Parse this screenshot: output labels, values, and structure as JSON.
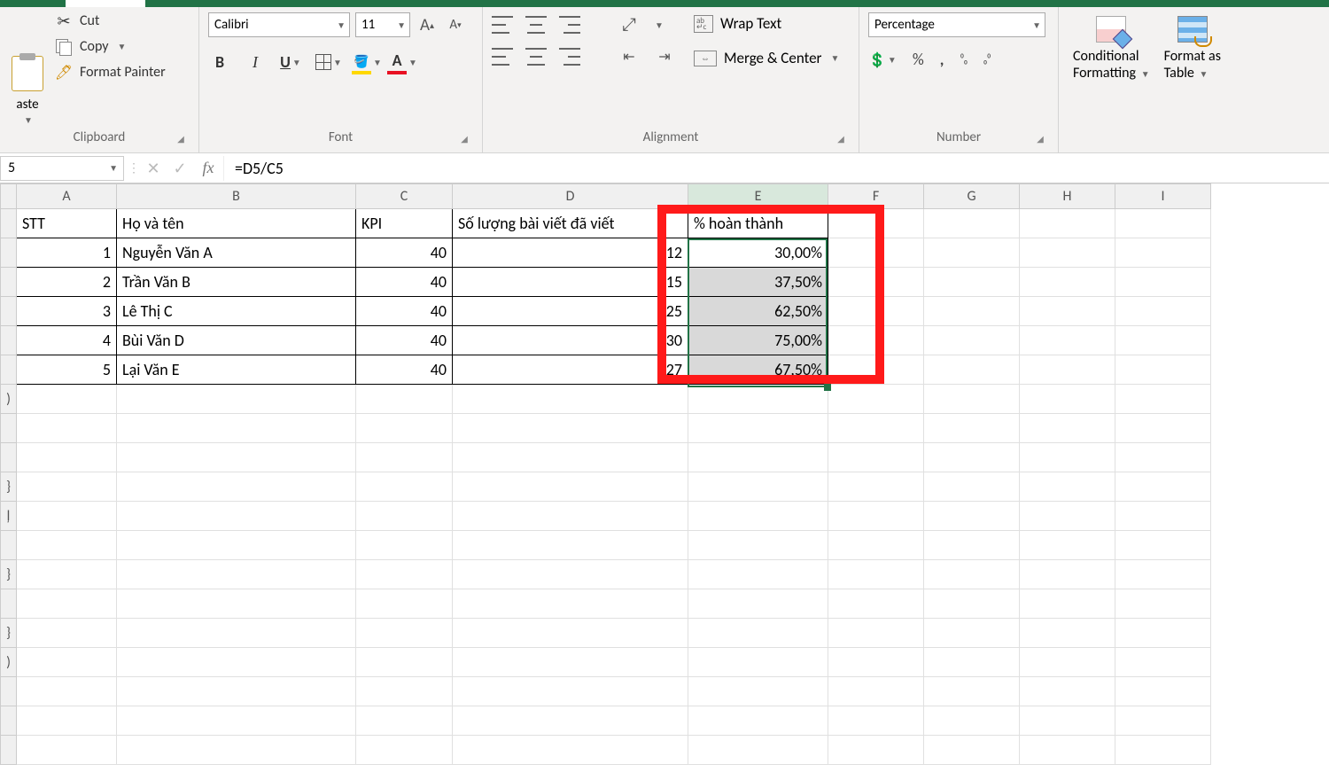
{
  "ribbon": {
    "clipboard": {
      "paste": "aste",
      "cut": "Cut",
      "copy": "Copy",
      "painter": "Format Painter",
      "label": "Clipboard"
    },
    "font": {
      "name": "Calibri",
      "size": "11",
      "bold": "B",
      "italic": "I",
      "underline": "U",
      "fontA": "A",
      "label": "Font"
    },
    "alignment": {
      "wrap": "Wrap Text",
      "merge": "Merge & Center",
      "label": "Alignment"
    },
    "number": {
      "format": "Percentage",
      "percent": "%",
      "comma": ",",
      "decInc": "←.0 .00",
      "decDec": ".00 →.0",
      "label": "Number"
    },
    "styles": {
      "conditional": "Conditional",
      "conditional2": "Formatting",
      "formatAs": "Format as",
      "formatAs2": "Table"
    }
  },
  "formulaBar": {
    "nameBox": "5",
    "cancel": "✕",
    "enter": "✓",
    "fx": "fx",
    "formula": "=D5/C5"
  },
  "columns": [
    "A",
    "B",
    "C",
    "D",
    "E",
    "F",
    "G",
    "H",
    "I"
  ],
  "headers": {
    "A": "STT",
    "B": "Họ và tên",
    "C": "KPI",
    "D": "Số lượng bài viết đã viết",
    "E": "% hoàn thành"
  },
  "rows": [
    {
      "stt": "1",
      "name": "Nguyễn Văn A",
      "kpi": "40",
      "qty": "12",
      "pct": "30,00%"
    },
    {
      "stt": "2",
      "name": "Trần Văn B",
      "kpi": "40",
      "qty": "15",
      "pct": "37,50%"
    },
    {
      "stt": "3",
      "name": "Lê Thị C",
      "kpi": "40",
      "qty": "25",
      "pct": "62,50%"
    },
    {
      "stt": "4",
      "name": "Bùi Văn D",
      "kpi": "40",
      "qty": "30",
      "pct": "75,00%"
    },
    {
      "stt": "5",
      "name": "Lại Văn E",
      "kpi": "40",
      "qty": "27",
      "pct": "67,50%"
    }
  ]
}
